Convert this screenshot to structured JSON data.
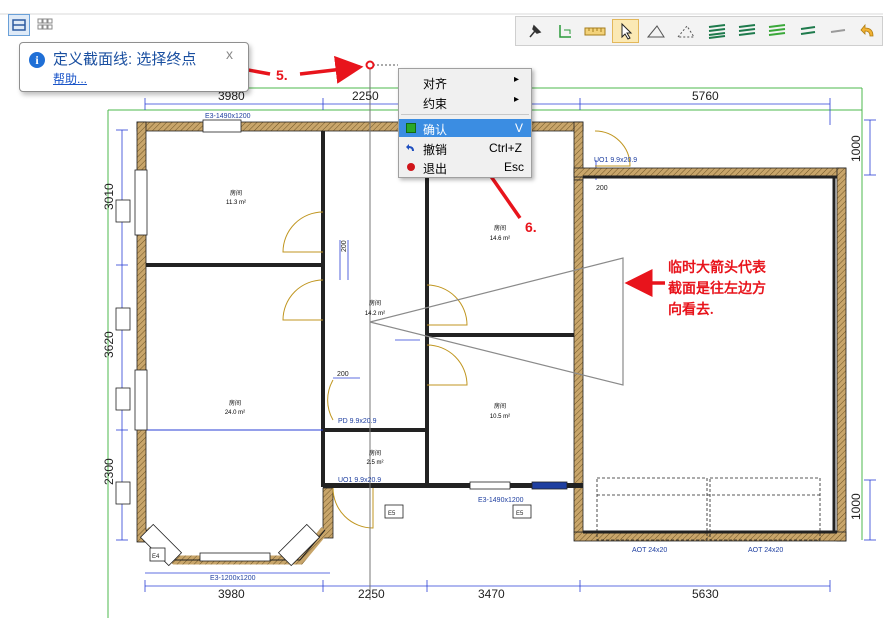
{
  "toolbar_left": {
    "icons": [
      "section-line-icon",
      "grid-view-icon"
    ]
  },
  "toolbar_right": {
    "icons": [
      "pin-icon",
      "snap-corner-icon",
      "ruler-icon",
      "pointer-icon",
      "triangle-icon",
      "dashed-triangle-icon",
      "stack-layers-icon",
      "stack-layers-alt-icon",
      "stack-layers-green-icon",
      "double-line-icon",
      "single-line-icon",
      "undo-arrow-icon"
    ],
    "active": "pointer-icon"
  },
  "tooltip": {
    "text": "定义截面线: 选择终点",
    "link": "帮助...",
    "close": "x"
  },
  "context_menu": {
    "items": [
      {
        "label": "对齐",
        "shortcut": "",
        "submenu": true
      },
      {
        "label": "约束",
        "shortcut": "",
        "submenu": true
      },
      {
        "label": "确认",
        "shortcut": "V",
        "icon": "green-square-icon",
        "selected": true
      },
      {
        "label": "撤销",
        "shortcut": "Ctrl+Z",
        "icon": "undo-icon"
      },
      {
        "label": "退出",
        "shortcut": "Esc",
        "icon": "red-dot-icon"
      }
    ],
    "submenu_arrow": "▸"
  },
  "annotations": {
    "step5": "5.",
    "step6": "6.",
    "note_line1": "临时大箭头代表",
    "note_line2": "截面是往左边方",
    "note_line3": "向看去."
  },
  "dimensions": {
    "top": [
      "3980",
      "2250",
      "5760"
    ],
    "bottom": [
      "3980",
      "2250",
      "3470",
      "5630"
    ],
    "left": [
      "3010",
      "3620",
      "2300"
    ],
    "right": [
      "1000",
      "1000"
    ],
    "small": [
      "200",
      "200",
      "200"
    ]
  },
  "rooms": [
    {
      "name": "房间",
      "area": "11.3 m²"
    },
    {
      "name": "房间",
      "area": "14.6 m²"
    },
    {
      "name": "房间",
      "area": "14.2 m²"
    },
    {
      "name": "房间",
      "area": "24.0 m²"
    },
    {
      "name": "房间",
      "area": "10.5 m²"
    },
    {
      "name": "房间",
      "area": "2.5 m²"
    }
  ],
  "labels": {
    "window_top": "E3-1490x1200",
    "window_bottom": "E3-1200x1200",
    "window_bottom_mid": "E3-1490x1200",
    "door1": "UO1 9.9x20.9",
    "door2": "UO1 9.9x20.9",
    "door_pd": "PD 9.9x20.9",
    "aot1": "AOT 24x20",
    "aot2": "AOT 24x20",
    "e5": "E5",
    "e1": "E1",
    "e4": "E4"
  },
  "colors": {
    "dim_blue": "#2a3fd6",
    "accent_red": "#e8141c",
    "wall_fill": "#c8a56a",
    "grid_green": "#4cb84c",
    "menu_select": "#3b8de2"
  }
}
